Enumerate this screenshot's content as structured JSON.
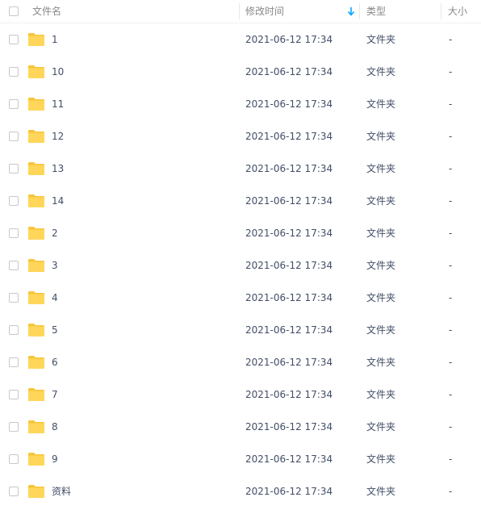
{
  "header": {
    "name": "文件名",
    "time": "修改时间",
    "type": "类型",
    "size": "大小"
  },
  "colors": {
    "folder": "#ffd659",
    "folder_back": "#f7c53a",
    "sort_arrow": "#06a7ff",
    "text": "#424e67",
    "header_text": "#888888"
  },
  "sort": {
    "column": "time",
    "direction": "descending",
    "icon": "arrow-down-icon"
  },
  "files": [
    {
      "name": "1",
      "time": "2021-06-12 17:34",
      "type": "文件夹",
      "size": "-"
    },
    {
      "name": "10",
      "time": "2021-06-12 17:34",
      "type": "文件夹",
      "size": "-"
    },
    {
      "name": "11",
      "time": "2021-06-12 17:34",
      "type": "文件夹",
      "size": "-"
    },
    {
      "name": "12",
      "time": "2021-06-12 17:34",
      "type": "文件夹",
      "size": "-"
    },
    {
      "name": "13",
      "time": "2021-06-12 17:34",
      "type": "文件夹",
      "size": "-"
    },
    {
      "name": "14",
      "time": "2021-06-12 17:34",
      "type": "文件夹",
      "size": "-"
    },
    {
      "name": "2",
      "time": "2021-06-12 17:34",
      "type": "文件夹",
      "size": "-"
    },
    {
      "name": "3",
      "time": "2021-06-12 17:34",
      "type": "文件夹",
      "size": "-"
    },
    {
      "name": "4",
      "time": "2021-06-12 17:34",
      "type": "文件夹",
      "size": "-"
    },
    {
      "name": "5",
      "time": "2021-06-12 17:34",
      "type": "文件夹",
      "size": "-"
    },
    {
      "name": "6",
      "time": "2021-06-12 17:34",
      "type": "文件夹",
      "size": "-"
    },
    {
      "name": "7",
      "time": "2021-06-12 17:34",
      "type": "文件夹",
      "size": "-"
    },
    {
      "name": "8",
      "time": "2021-06-12 17:34",
      "type": "文件夹",
      "size": "-"
    },
    {
      "name": "9",
      "time": "2021-06-12 17:34",
      "type": "文件夹",
      "size": "-"
    },
    {
      "name": "资料",
      "time": "2021-06-12 17:34",
      "type": "文件夹",
      "size": "-"
    }
  ]
}
